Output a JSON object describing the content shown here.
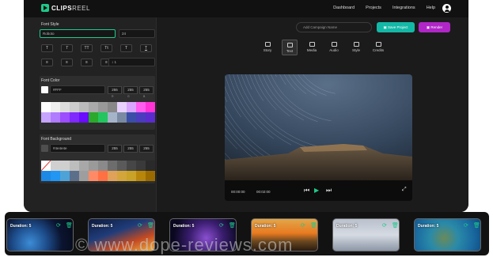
{
  "topbar": {
    "logo_bold": "CLIPS",
    "logo_thin": "REEL",
    "nav": [
      "Dashboard",
      "Projects",
      "Integrations",
      "Help"
    ]
  },
  "sidebar": {
    "font_style_label": "Font Style",
    "font_family_value": "Roboto",
    "font_size_value": "24",
    "text_style_buttons": [
      "T",
      "T",
      "TT",
      "Tt",
      "T",
      "T"
    ],
    "line_height_value": "1",
    "font_color_label": "Font Color",
    "font_color_hex": "#FFF",
    "font_color_rgb": [
      "255",
      "255",
      "255"
    ],
    "font_background_label": "Font Background",
    "font_background_hex": "#4e4e4e",
    "font_background_rgb": [
      "255",
      "255",
      "255"
    ],
    "rgb_labels": [
      "R",
      "G",
      "B"
    ],
    "color_swatches": [
      "#ffffff",
      "#eeeeee",
      "#dddddd",
      "#cccccc",
      "#bbbbbb",
      "#aaaaaa",
      "#999999",
      "#888888",
      "#e8d1ff",
      "#d9a5ff",
      "#ff5cf0",
      "#ff33d6",
      "#c6a5ff",
      "#b07bff",
      "#9c4dff",
      "#7f29ff",
      "#6a0cff",
      "#2aa92a",
      "#22c55e",
      "#a5b4c8",
      "#7a8aa3",
      "#3a4ea8",
      "#4b3bbd",
      "#5a2ccc"
    ],
    "bg_swatches": [
      "#ffffff",
      "#d0d0d0",
      "#cfcfcf",
      "#bdbdbd",
      "#a8a8a8",
      "#9a9a9a",
      "#8a8a8a",
      "#6d6d6d",
      "#5a5a5a",
      "#464646",
      "#3a3a3a",
      "#2a2a2a",
      "#1e88e5",
      "#2196f3",
      "#4da3d8",
      "#5c6f8a",
      "#9e9e9e",
      "#ff8a65",
      "#ff7043",
      "#e0a15a",
      "#d4a53a",
      "#c9a227",
      "#b8860b",
      "#9c6b00"
    ]
  },
  "toolbar": {
    "campaign_placeholder": "Add Campaign Name",
    "save_label": "Save Project",
    "render_label": "Render",
    "tabs": [
      "Story",
      "Text",
      "Media",
      "Audio",
      "Style",
      "Credits"
    ],
    "active_tab": "Text"
  },
  "player": {
    "current_time": "00:00:00",
    "total_time": "00:02:00"
  },
  "timeline": {
    "clips": [
      {
        "duration": "Duration: 5",
        "theme": "earth"
      },
      {
        "duration": "Duration: 5",
        "theme": "highway"
      },
      {
        "duration": "Duration: 5",
        "theme": "galaxy"
      },
      {
        "duration": "Duration: 5",
        "theme": "sunset"
      },
      {
        "duration": "Duration: 5",
        "theme": "laptop"
      },
      {
        "duration": "Duration: 5",
        "theme": "turtle"
      }
    ]
  },
  "watermark": "© www.dope-reviews.com",
  "colors": {
    "accent_green": "#1fc98a",
    "save_teal": "#14b8a6",
    "render_purple": "#b026c7"
  }
}
